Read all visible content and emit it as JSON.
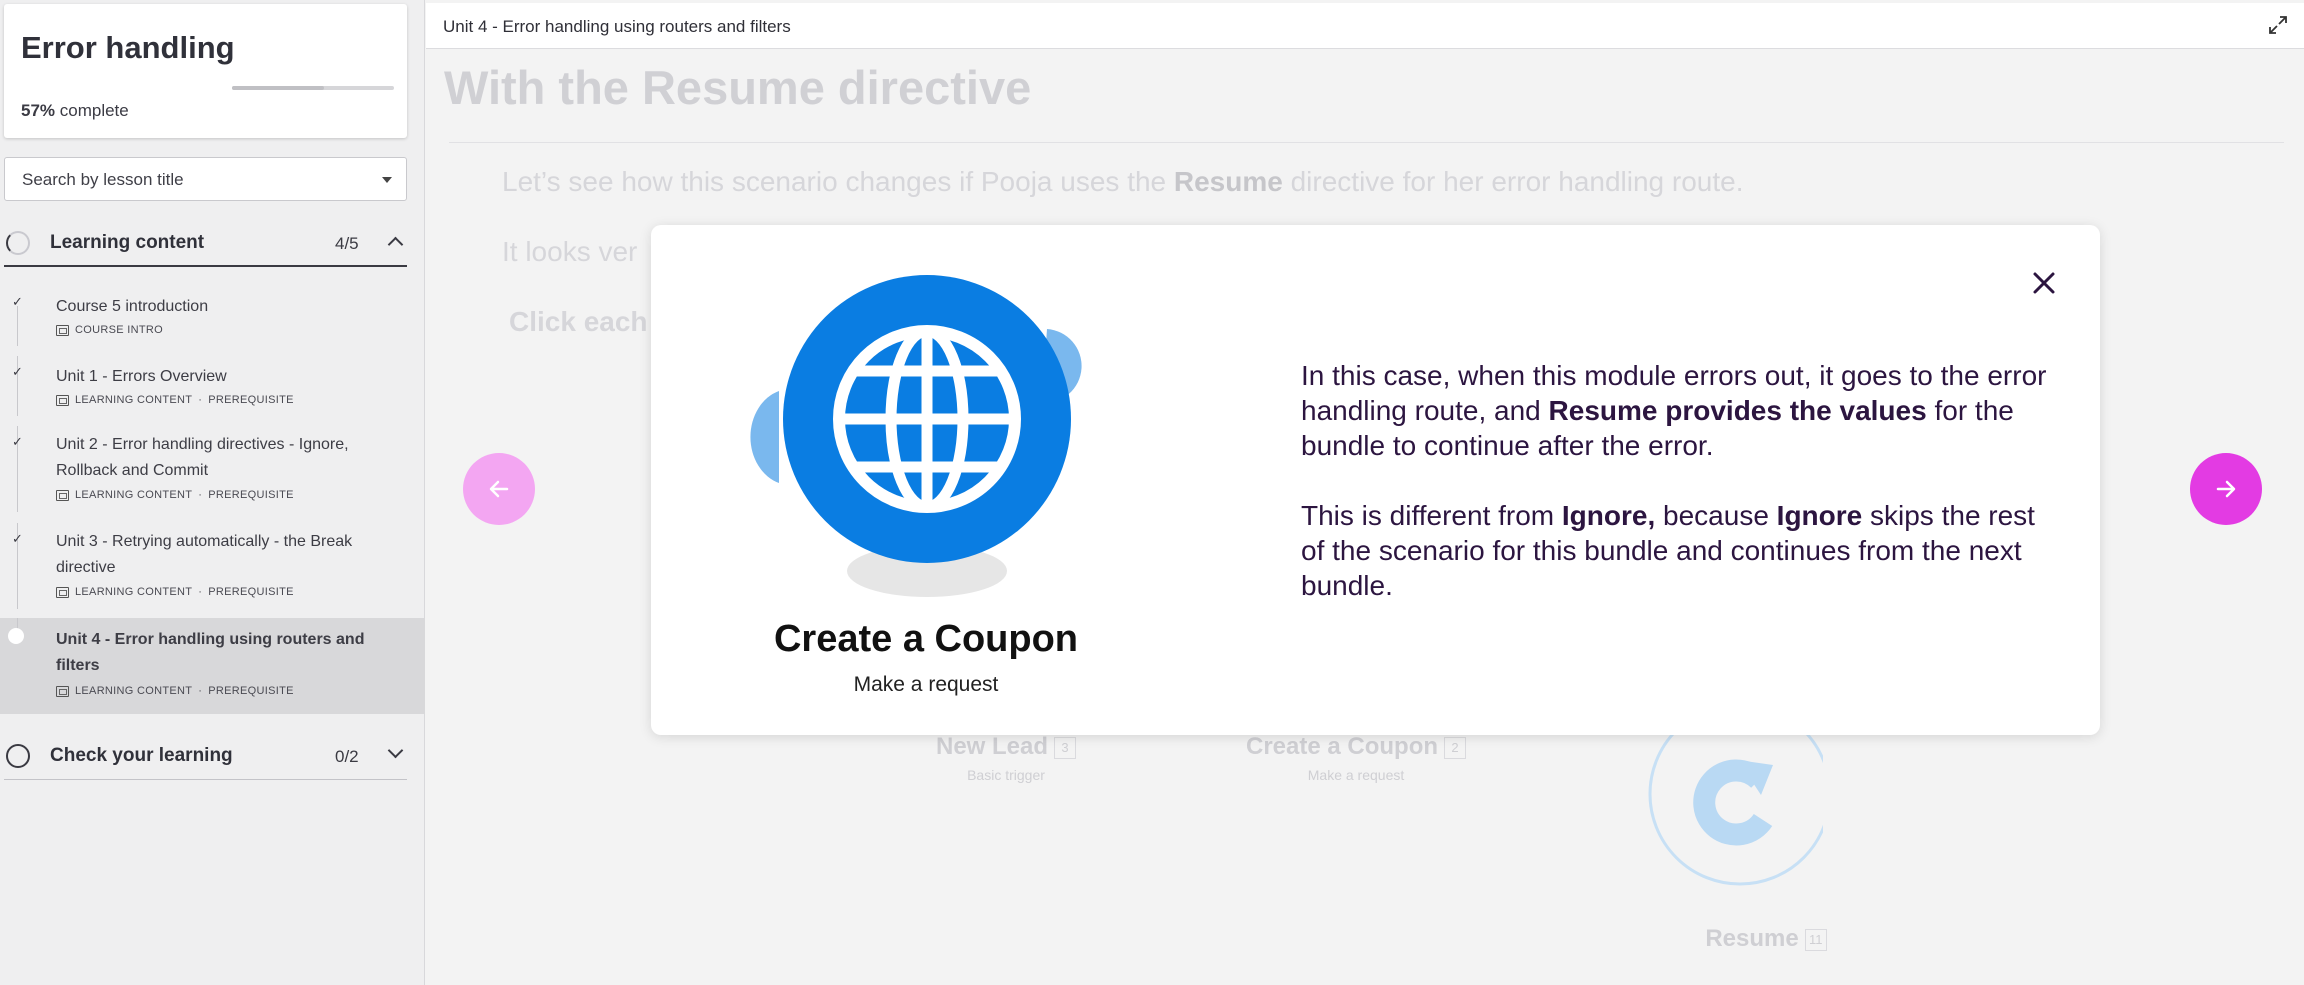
{
  "sidebar": {
    "course_title": "Error handling",
    "progress_percent": "57%",
    "progress_suffix": " complete",
    "progress_value": 0.57,
    "search_placeholder": "Search by lesson title",
    "sections": [
      {
        "label": "Learning content",
        "count": "4/5"
      },
      {
        "label": "Check your learning",
        "count": "0/2"
      }
    ],
    "lessons": [
      {
        "title": "Course 5 introduction",
        "meta_type": "COURSE INTRO",
        "meta_tag": "",
        "state": "complete"
      },
      {
        "title": "Unit 1 - Errors Overview",
        "meta_type": "LEARNING CONTENT",
        "meta_tag": "PREREQUISITE",
        "state": "complete"
      },
      {
        "title": "Unit 2 - Error handling directives - Ignore, Rollback and Commit",
        "meta_type": "LEARNING CONTENT",
        "meta_tag": "PREREQUISITE",
        "state": "complete"
      },
      {
        "title": "Unit 3 - Retrying automatically - the Break directive",
        "meta_type": "LEARNING CONTENT",
        "meta_tag": "PREREQUISITE",
        "state": "complete"
      },
      {
        "title": "Unit 4 - Error handling using routers and filters",
        "meta_type": "LEARNING CONTENT",
        "meta_tag": "PREREQUISITE",
        "state": "current"
      }
    ],
    "meta_separator": "·"
  },
  "main": {
    "breadcrumb": "Unit 4 - Error handling using routers and filters",
    "heading": "With the Resume directive",
    "bg_line1_pre": "Let’s see how this scenario changes if Pooja uses the ",
    "bg_line1_bold": "Resume",
    "bg_line1_post": " directive for her error handling route.",
    "bg_line2": "It looks ver",
    "bg_line3": "Click each",
    "bg_nodes": [
      {
        "name": "New Lead",
        "num": "3",
        "sub": "Basic trigger"
      },
      {
        "name": "Create a Coupon",
        "num": "2",
        "sub": "Make a request"
      },
      {
        "name": "Resume",
        "num": "11",
        "sub": ""
      }
    ]
  },
  "modal": {
    "module_title": "Create a Coupon",
    "module_subtitle": "Make a request",
    "p1_a": "In this case, when this module errors out, it goes to the error handling route, and ",
    "p1_b": "Resume provides the values",
    "p1_c": " for the bundle to continue after the error.",
    "p2_a": "This is different from ",
    "p2_b": "Ignore,",
    "p2_c": " because ",
    "p2_d": "Ignore",
    "p2_e": " skips the rest of the scenario for this bundle and continues from the next bundle."
  },
  "colors": {
    "accent_magenta": "#e33be3",
    "accent_magenta_light": "#f3a6f2",
    "module_blue": "#0a7de2",
    "module_blue_light": "#7ab8ee",
    "modal_text": "#2c1540"
  },
  "icons": [
    "expand-icon",
    "close-icon",
    "arrow-left-icon",
    "arrow-right-icon",
    "check-icon",
    "lesson-icon",
    "globe-icon",
    "chevron-up-icon",
    "chevron-down-icon"
  ]
}
